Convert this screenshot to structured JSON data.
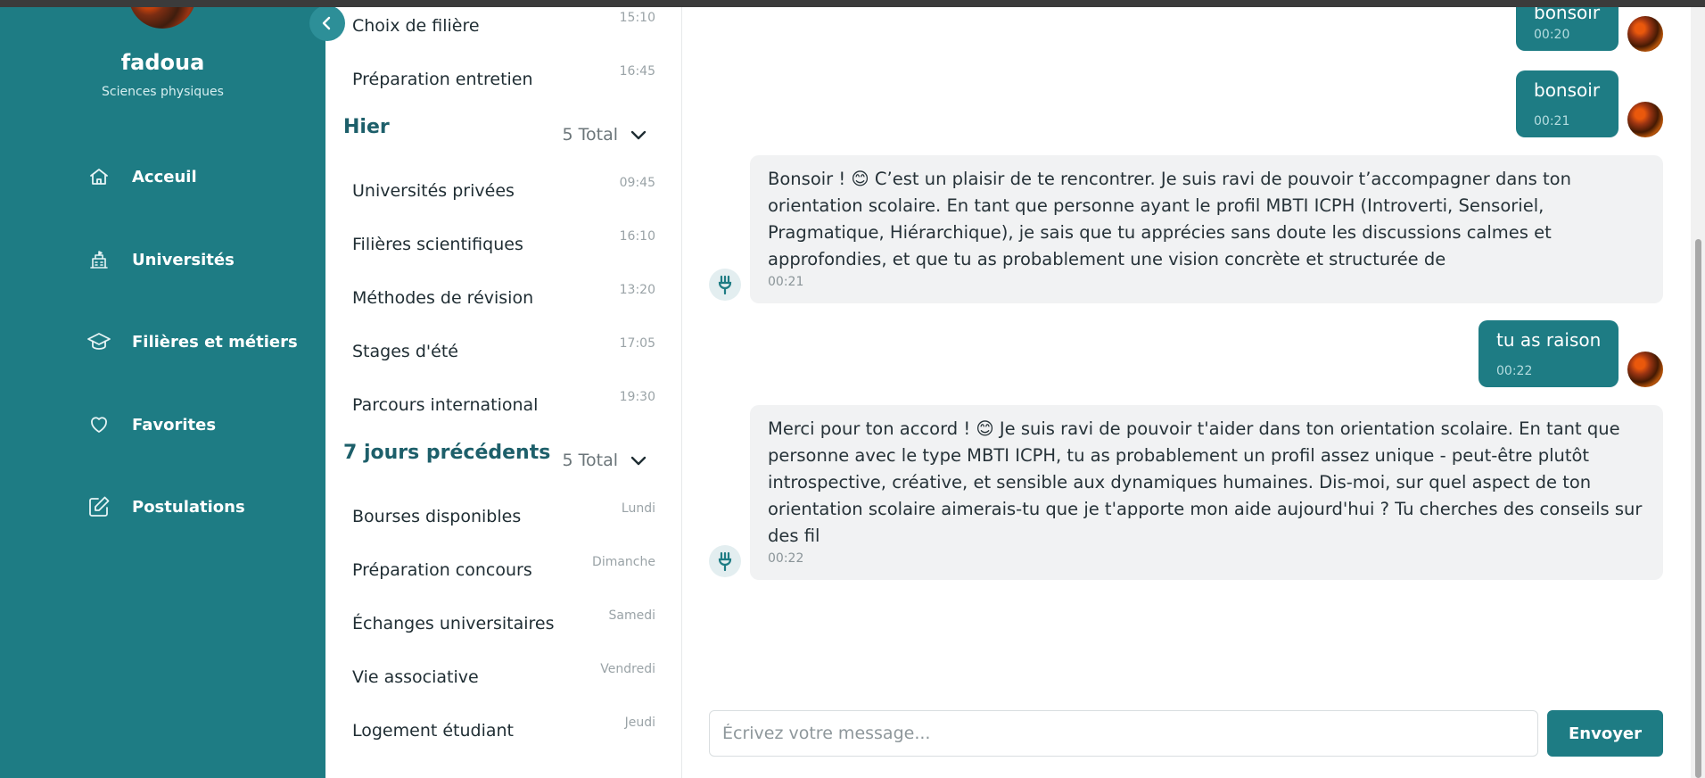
{
  "profile": {
    "name": "fadoua",
    "track": "Sciences physiques"
  },
  "sidebar": {
    "items": [
      {
        "label": "Acceuil",
        "icon": "home-icon"
      },
      {
        "label": "Universités",
        "icon": "university-icon"
      },
      {
        "label": "Filières et métiers",
        "icon": "graduation-cap-icon"
      },
      {
        "label": "Favorites",
        "icon": "heart-icon"
      },
      {
        "label": "Postulations",
        "icon": "edit-icon"
      }
    ]
  },
  "conversations": {
    "today": [
      {
        "title": "Choix de filière",
        "time": "15:10"
      },
      {
        "title": "Préparation entretien",
        "time": "16:45"
      }
    ],
    "yesterday": {
      "title": "Hier",
      "total": "5 Total",
      "items": [
        {
          "title": "Universités privées",
          "time": "09:45"
        },
        {
          "title": "Filières scientifiques",
          "time": "16:10"
        },
        {
          "title": "Méthodes de révision",
          "time": "13:20"
        },
        {
          "title": "Stages d'été",
          "time": "17:05"
        },
        {
          "title": "Parcours international",
          "time": "19:30"
        }
      ]
    },
    "last7": {
      "title": "7 jours précédents",
      "total": "5 Total",
      "items": [
        {
          "title": "Bourses disponibles",
          "time": "Lundi"
        },
        {
          "title": "Préparation concours",
          "time": "Dimanche"
        },
        {
          "title": "Échanges universitaires",
          "time": "Samedi"
        },
        {
          "title": "Vie associative",
          "time": "Vendredi"
        },
        {
          "title": "Logement étudiant",
          "time": "Jeudi"
        }
      ]
    }
  },
  "messages": [
    {
      "from": "user",
      "text": "bonsoir",
      "time": "00:20"
    },
    {
      "from": "user",
      "text": "bonsoir",
      "time": "00:21"
    },
    {
      "from": "bot",
      "text": "Bonsoir ! 😊 C’est un plaisir de te rencontrer. Je suis ravi de pouvoir t’accompagner dans ton orientation scolaire. En tant que personne ayant le profil MBTI ICPH (Introverti, Sensoriel, Pragmatique, Hiérarchique), je sais que tu apprécies sans doute les discussions calmes et approfondies, et que tu as probablement une vision concrète et structurée de",
      "time": "00:21"
    },
    {
      "from": "user",
      "text": "tu as raison",
      "time": "00:22"
    },
    {
      "from": "bot",
      "text": "Merci pour ton accord ! 😊 Je suis ravi de pouvoir t'aider dans ton orientation scolaire. En tant que personne avec le type MBTI ICPH, tu as probablement un profil assez unique - peut-être plutôt introspective, créative, et sensible aux dynamiques humaines. Dis-moi, sur quel aspect de ton orientation scolaire aimerais-tu que je t'apporte mon aide aujourd'hui ? Tu cherches des conseils sur des fil",
      "time": "00:22"
    }
  ],
  "composer": {
    "placeholder": "Écrivez votre message...",
    "value": "",
    "send_label": "Envoyer"
  },
  "colors": {
    "primary": "#1e7c84",
    "heading": "#1d5f6a",
    "bot_bubble": "#f1f2f3"
  }
}
